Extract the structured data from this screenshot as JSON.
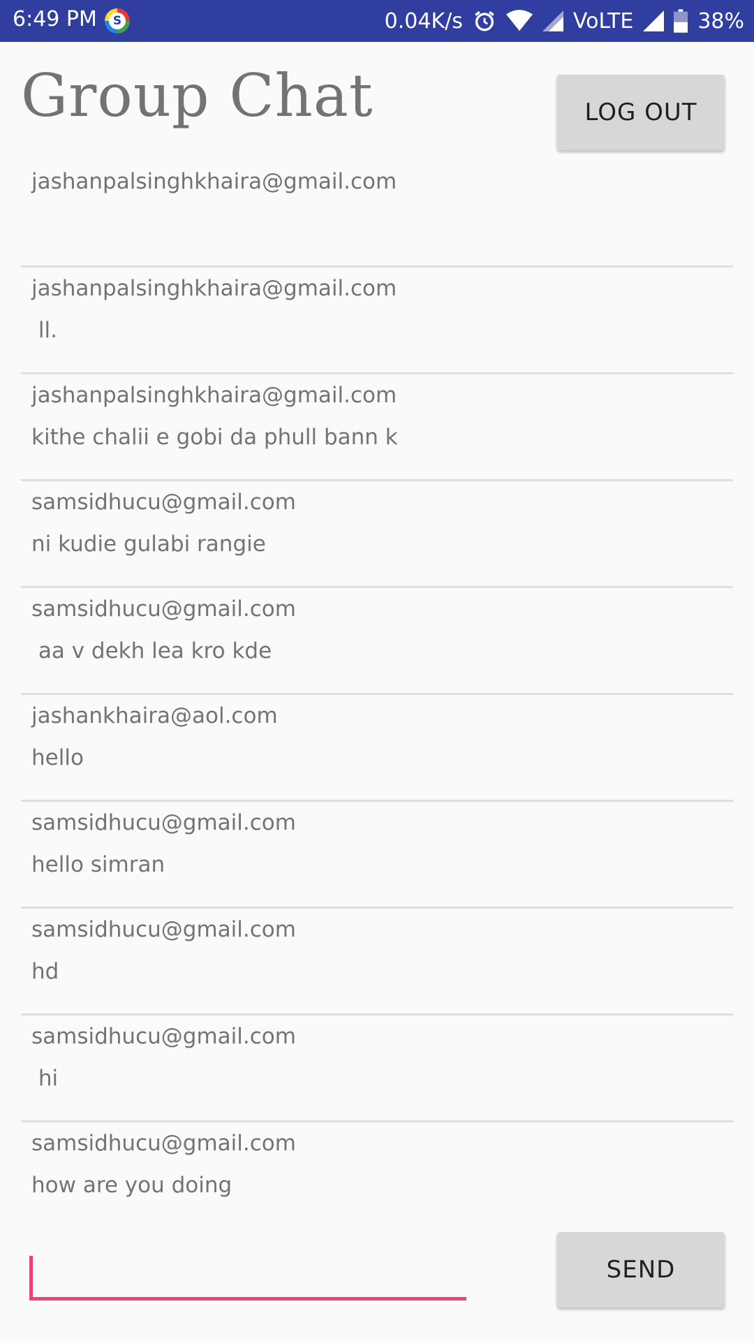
{
  "status_bar": {
    "time": "6:49 PM",
    "notif_icon_letter": "S",
    "net_speed": "0.04K/s",
    "network_type": "VoLTE",
    "battery": "38%",
    "icons": [
      "alarm-icon",
      "wifi-icon",
      "signal-icon",
      "signal-icon",
      "battery-icon"
    ]
  },
  "header": {
    "title": "Group Chat",
    "logout_label": "LOG OUT"
  },
  "messages": [
    {
      "sender": "jashanpalsinghkhaira@gmail.com",
      "text": ""
    },
    {
      "sender": "jashanpalsinghkhaira@gmail.com",
      "text": " ll."
    },
    {
      "sender": "jashanpalsinghkhaira@gmail.com",
      "text": "kithe chalii e gobi da phull bann k"
    },
    {
      "sender": "samsidhucu@gmail.com",
      "text": "ni kudie gulabi rangie"
    },
    {
      "sender": "samsidhucu@gmail.com",
      "text": " aa v dekh lea kro kde"
    },
    {
      "sender": "jashankhaira@aol.com",
      "text": "hello"
    },
    {
      "sender": "samsidhucu@gmail.com",
      "text": "hello simran"
    },
    {
      "sender": "samsidhucu@gmail.com",
      "text": "hd"
    },
    {
      "sender": "samsidhucu@gmail.com",
      "text": " hi"
    },
    {
      "sender": "samsidhucu@gmail.com",
      "text": "how are you doing"
    }
  ],
  "composer": {
    "input_value": "",
    "placeholder": "",
    "send_label": "SEND"
  },
  "colors": {
    "status_bar": "#303f9f",
    "accent": "#e8437a",
    "button_bg": "#d6d7d7",
    "text": "#737373"
  }
}
